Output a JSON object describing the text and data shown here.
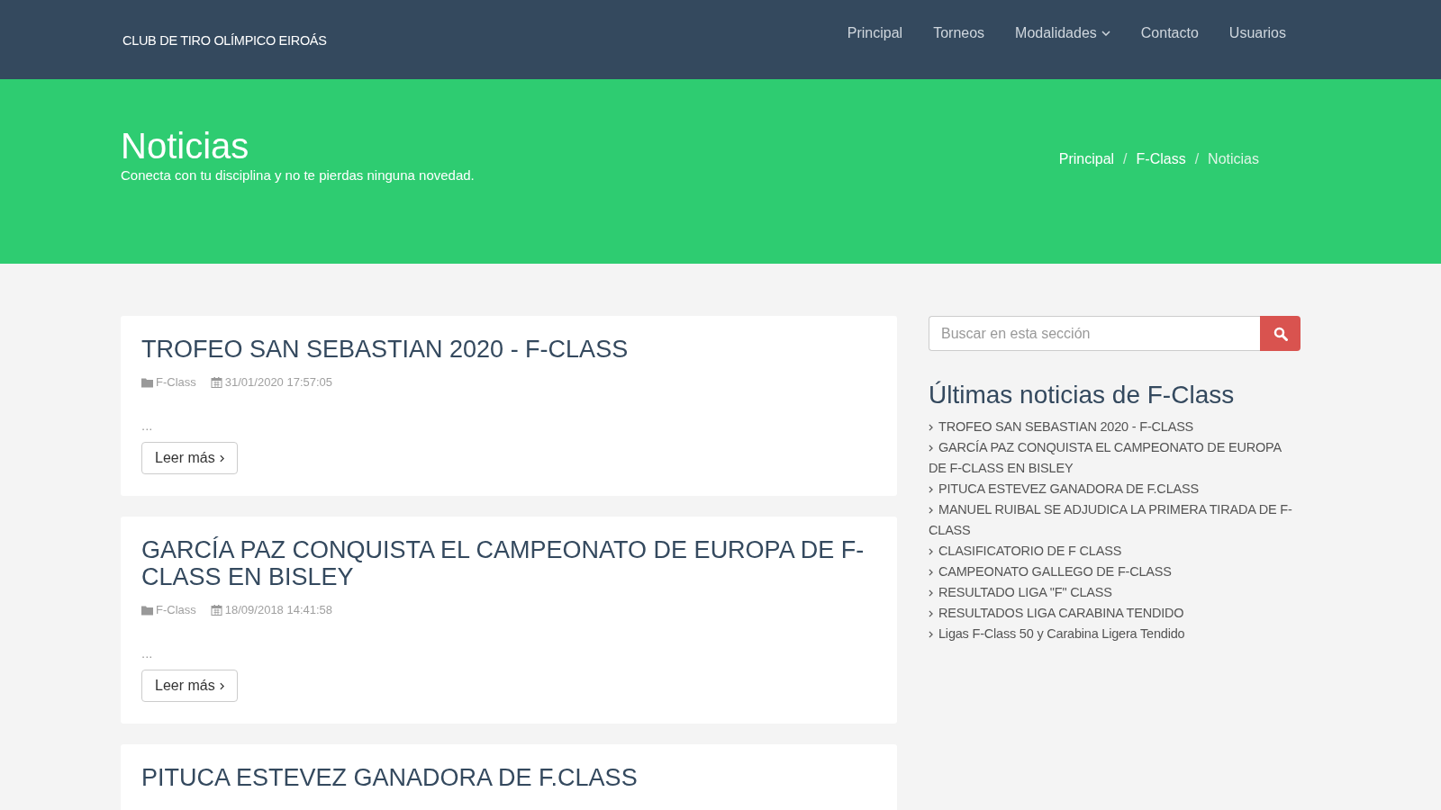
{
  "header": {
    "brand": "CLUB DE TIRO OLÍMPICO EIROÁS",
    "nav": [
      {
        "label": "Principal",
        "has_menu": false
      },
      {
        "label": "Torneos",
        "has_menu": false
      },
      {
        "label": "Modalidades",
        "has_menu": true
      },
      {
        "label": "Contacto",
        "has_menu": false
      },
      {
        "label": "Usuarios",
        "has_menu": false
      }
    ]
  },
  "banner": {
    "title": "Noticias",
    "subtitle": "Conecta con tu disciplina y no te pierdas ninguna novedad.",
    "breadcrumb_separator": "/",
    "breadcrumb": [
      {
        "label": "Principal",
        "current": false
      },
      {
        "label": "F-Class",
        "current": false
      },
      {
        "label": "Noticias",
        "current": true
      }
    ]
  },
  "posts": [
    {
      "title": "TROFEO SAN SEBASTIAN 2020 - F-CLASS",
      "category": "F-Class",
      "date": "31/01/2020 17:57:05",
      "excerpt": "...",
      "button": "Leer más"
    },
    {
      "title": "GARCÍA PAZ CONQUISTA EL CAMPEONATO DE EUROPA DE F-CLASS EN BISLEY",
      "category": "F-Class",
      "date": "18/09/2018 14:41:58",
      "excerpt": "...",
      "button": "Leer más"
    },
    {
      "title": "PITUCA ESTEVEZ GANADORA DE F.CLASS"
    }
  ],
  "sidebar": {
    "search": {
      "placeholder": "Buscar en esta sección"
    },
    "heading": "Últimas noticias de F-Class",
    "links": [
      "TROFEO SAN SEBASTIAN 2020 - F-CLASS",
      "GARCÍA PAZ CONQUISTA EL CAMPEONATO DE EUROPA DE F-CLASS EN BISLEY",
      "PITUCA ESTEVEZ GANADORA DE F.CLASS",
      "MANUEL RUIBAL SE ADJUDICA LA PRIMERA TIRADA DE F-CLASS",
      "CLASIFICATORIO DE F CLASS",
      "CAMPEONATO GALLEGO DE F-CLASS",
      "RESULTADO LIGA \"F\" CLASS",
      "RESULTADOS LIGA CARABINA TENDIDO",
      "Ligas F-Class 50 y Carabina Ligera Tendido"
    ]
  }
}
